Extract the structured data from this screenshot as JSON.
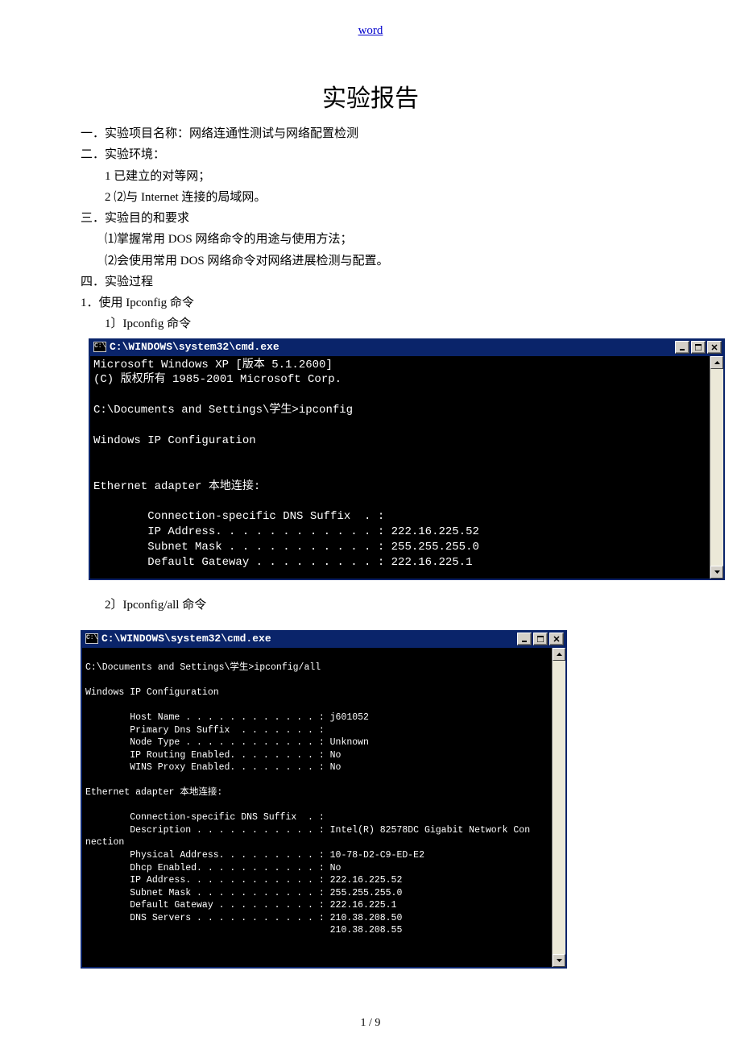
{
  "header": {
    "link": "word"
  },
  "title": "实验报告",
  "sections": {
    "s1": "一．实验项目名称：网络连通性测试与网络配置检测",
    "s2": "二．实验环境：",
    "s2_1": "1    已建立的对等网；",
    "s2_2": "2    ⑵与 Internet 连接的局域网。",
    "s3": "三．实验目的和要求",
    "s3_1": "⑴掌握常用 DOS 网络命令的用途与使用方法；",
    "s3_2": "⑵会使用常用 DOS 网络命令对网络进展检测与配置。",
    "s4": "四．实验过程",
    "s4_1": "1．使用 Ipconfig 命令",
    "s4_1_1": "1〕Ipconfig 命令",
    "s4_1_2": "2〕Ipconfig/all  命令"
  },
  "cmd1": {
    "title_icon": "C:\\",
    "title": "C:\\WINDOWS\\system32\\cmd.exe",
    "content": "Microsoft Windows XP [版本 5.1.2600]\n(C) 版权所有 1985-2001 Microsoft Corp.\n\nC:\\Documents and Settings\\学生>ipconfig\n\nWindows IP Configuration\n\n\nEthernet adapter 本地连接:\n\n        Connection-specific DNS Suffix  . :\n        IP Address. . . . . . . . . . . . : 222.16.225.52\n        Subnet Mask . . . . . . . . . . . : 255.255.255.0\n        Default Gateway . . . . . . . . . : 222.16.225.1"
  },
  "cmd2": {
    "title_icon": "C:\\",
    "title": "C:\\WINDOWS\\system32\\cmd.exe",
    "content": "\nC:\\Documents and Settings\\学生>ipconfig/all\n\nWindows IP Configuration\n\n        Host Name . . . . . . . . . . . . : j601052\n        Primary Dns Suffix  . . . . . . . :\n        Node Type . . . . . . . . . . . . : Unknown\n        IP Routing Enabled. . . . . . . . : No\n        WINS Proxy Enabled. . . . . . . . : No\n\nEthernet adapter 本地连接:\n\n        Connection-specific DNS Suffix  . :\n        Description . . . . . . . . . . . : Intel(R) 82578DC Gigabit Network Con\nnection\n        Physical Address. . . . . . . . . : 10-78-D2-C9-ED-E2\n        Dhcp Enabled. . . . . . . . . . . : No\n        IP Address. . . . . . . . . . . . : 222.16.225.52\n        Subnet Mask . . . . . . . . . . . : 255.255.255.0\n        Default Gateway . . . . . . . . . : 222.16.225.1\n        DNS Servers . . . . . . . . . . . : 210.38.208.50\n                                            210.38.208.55"
  },
  "footer": "1 / 9"
}
